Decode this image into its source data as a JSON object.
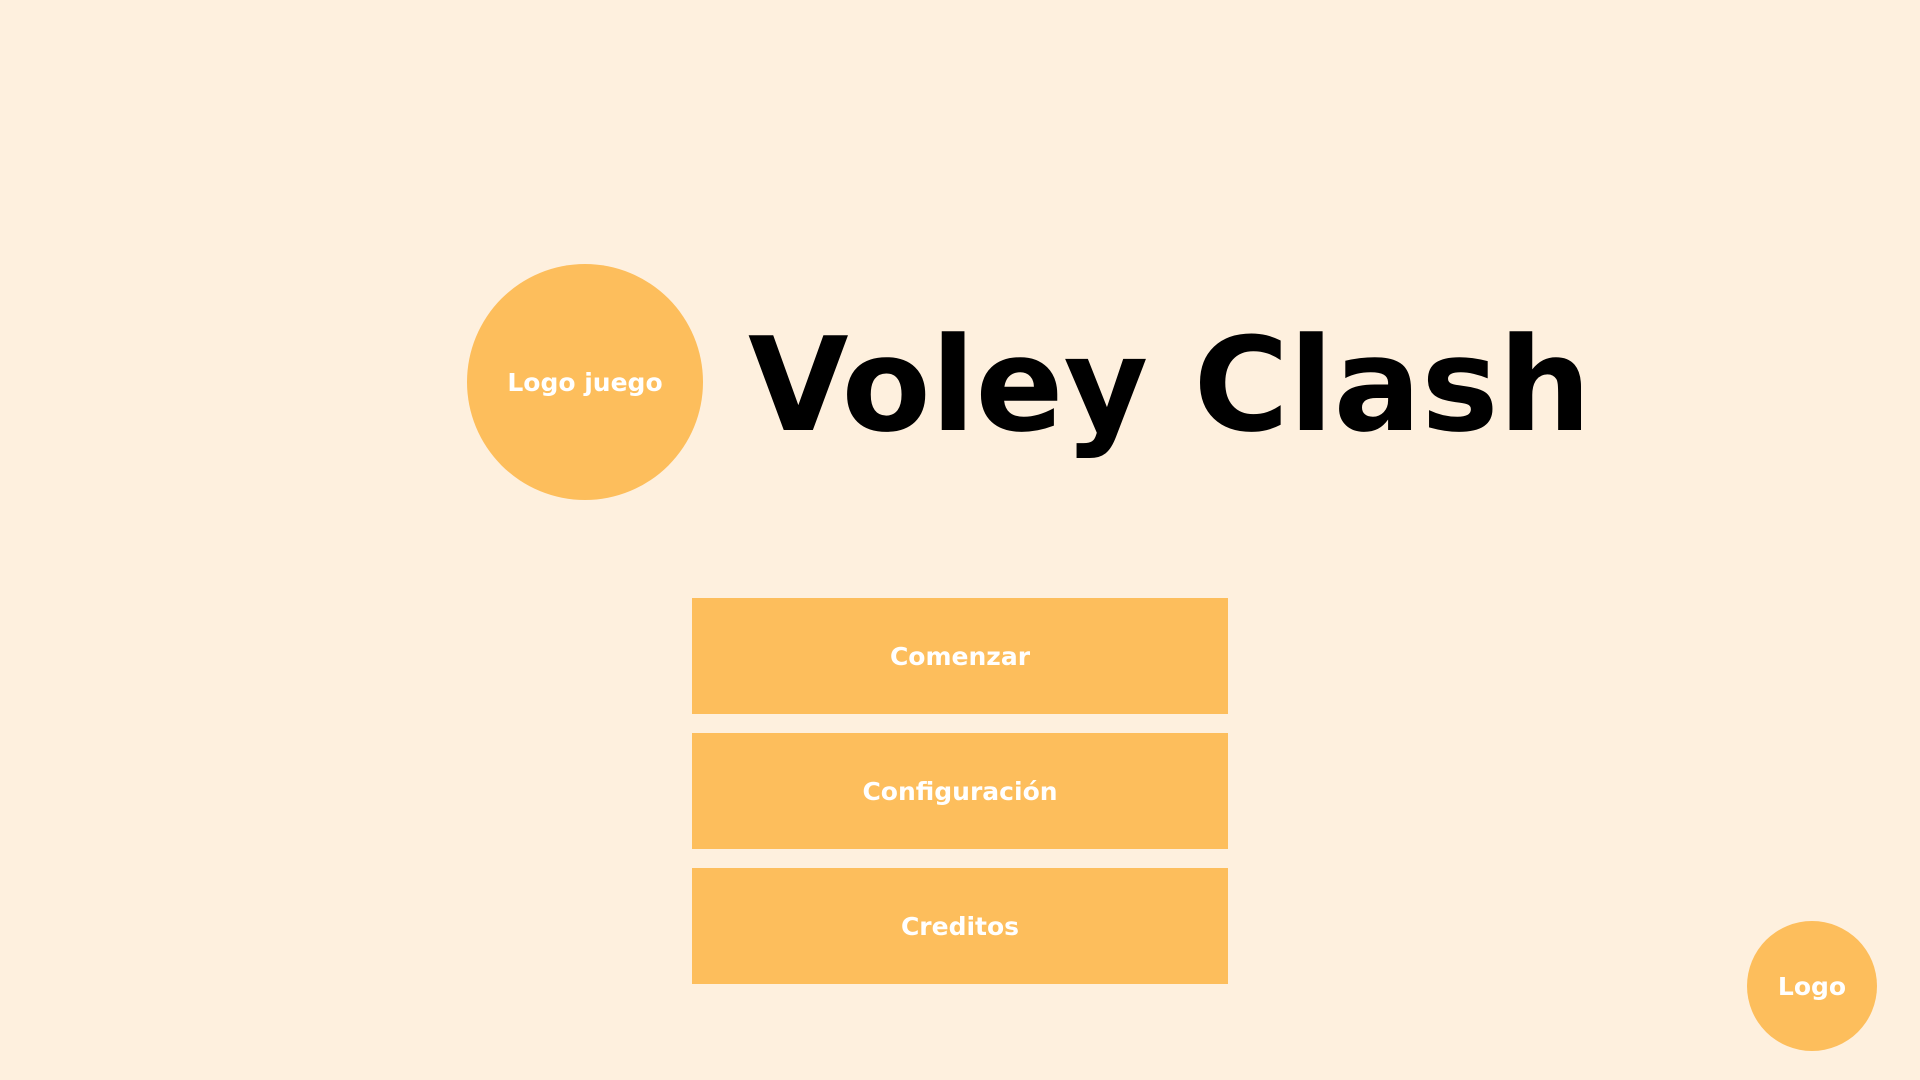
{
  "header": {
    "logo_label": "Logo juego",
    "title": "Voley Clash"
  },
  "menu": {
    "items": [
      {
        "label": "Comenzar"
      },
      {
        "label": "Configuración"
      },
      {
        "label": "Creditos"
      }
    ]
  },
  "footer": {
    "logo_label": "Logo"
  },
  "colors": {
    "background": "#FEF0DE",
    "accent": "#FDBE5C",
    "title_text": "#000000",
    "button_text": "#FFFFFF"
  }
}
